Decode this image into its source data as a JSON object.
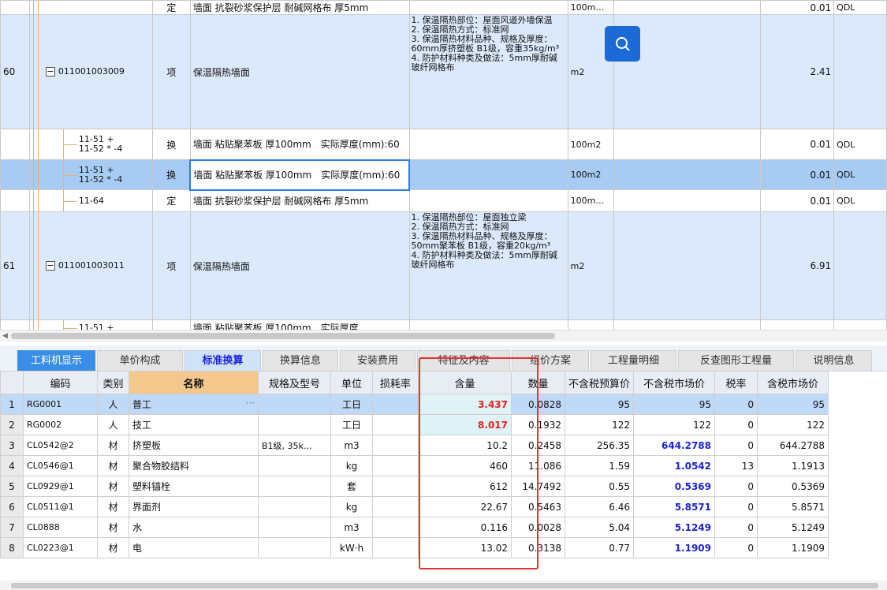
{
  "top_table": {
    "rows": [
      {
        "num": "",
        "code": "",
        "type": "定",
        "name": "墙面 抗裂砂浆保护层 耐碱网格布 厚5mm",
        "desc": "",
        "unit": "100m…",
        "qty": "0.01",
        "qdl": "QDL"
      },
      {
        "num": "60",
        "code": "011001003009",
        "type": "项",
        "name": "保温隔热墙面",
        "desc": "1. 保温隔热部位：屋面风道外墙保温\n2. 保温隔热方式：标准网\n3. 保温隔热材料品种、规格及厚度：60mm厚挤塑板 B1级，容重35kg/m³\n4. 防护材料种类及做法：5mm厚耐碱玻纤网格布",
        "unit": "m2",
        "qty": "2.41",
        "qdl": ""
      },
      {
        "num": "",
        "code": "11-51 +\n11-52 * -4",
        "type": "换",
        "name": "墙面 粘贴聚苯板 厚100mm　实际厚度(mm):60",
        "desc": "",
        "unit": "100m2",
        "qty": "0.01",
        "qdl": "QDL"
      },
      {
        "num": "",
        "code": "11-51 +\n11-52 * -4",
        "type": "换",
        "name": "墙面 粘贴聚苯板 厚100mm　实际厚度(mm):60",
        "desc": "",
        "unit": "100m2",
        "qty": "0.01",
        "qdl": "QDL"
      },
      {
        "num": "",
        "code": "11-64",
        "type": "定",
        "name": "墙面 抗裂砂浆保护层 耐碱网格布 厚5mm",
        "desc": "",
        "unit": "100m…",
        "qty": "0.01",
        "qdl": "QDL"
      },
      {
        "num": "61",
        "code": "011001003011",
        "type": "项",
        "name": "保温隔热墙面",
        "desc": "1. 保温隔热部位：屋面独立梁\n2. 保温隔热方式：标准网\n3. 保温隔热材料品种、规格及厚度：50mm聚苯板 B1级，容重20kg/m³\n4. 防护材料种类及做法：5mm厚耐碱玻纤网格布",
        "unit": "m2",
        "qty": "6.91",
        "qdl": ""
      },
      {
        "num": "",
        "code": "11-51 +",
        "type": "",
        "name": "墙面 粘贴聚苯板 厚100mm　实际厚度",
        "desc": "",
        "unit": "",
        "qty": "",
        "qdl": ""
      }
    ]
  },
  "tabs": [
    "工料机显示",
    "单价构成",
    "标准换算",
    "换算信息",
    "安装费用",
    "特征及内容",
    "组价方案",
    "工程量明细",
    "反查图形工程量",
    "说明信息"
  ],
  "bottom_table": {
    "headers": [
      "编码",
      "类别",
      "名称",
      "规格及型号",
      "单位",
      "损耗率",
      "含量",
      "数量",
      "不含税预算价",
      "不含税市场价",
      "税率",
      "含税市场价"
    ],
    "rows": [
      {
        "n": "1",
        "code": "RG0001",
        "cat": "人",
        "name": "普工",
        "spec": "",
        "unit": "工日",
        "loss": "",
        "qty": "3.437",
        "amount": "0.0828",
        "budget": "95",
        "market": "95",
        "tax": "0",
        "taxm": "95"
      },
      {
        "n": "2",
        "code": "RG0002",
        "cat": "人",
        "name": "技工",
        "spec": "",
        "unit": "工日",
        "loss": "",
        "qty": "8.017",
        "amount": "0.1932",
        "budget": "122",
        "market": "122",
        "tax": "0",
        "taxm": "122"
      },
      {
        "n": "3",
        "code": "CL0542@2",
        "cat": "材",
        "name": "挤塑板",
        "spec": "B1级, 35k…",
        "unit": "m3",
        "loss": "",
        "qty": "10.2",
        "amount": "0.2458",
        "budget": "256.35",
        "market": "644.2788",
        "tax": "0",
        "taxm": "644.2788"
      },
      {
        "n": "4",
        "code": "CL0546@1",
        "cat": "材",
        "name": "聚合物胶结料",
        "spec": "",
        "unit": "kg",
        "loss": "",
        "qty": "460",
        "amount": "11.086",
        "budget": "1.59",
        "market": "1.0542",
        "tax": "13",
        "taxm": "1.1913"
      },
      {
        "n": "5",
        "code": "CL0929@1",
        "cat": "材",
        "name": "塑料锚栓",
        "spec": "",
        "unit": "套",
        "loss": "",
        "qty": "612",
        "amount": "14.7492",
        "budget": "0.55",
        "market": "0.5369",
        "tax": "0",
        "taxm": "0.5369"
      },
      {
        "n": "6",
        "code": "CL0511@1",
        "cat": "材",
        "name": "界面剂",
        "spec": "",
        "unit": "kg",
        "loss": "",
        "qty": "22.67",
        "amount": "0.5463",
        "budget": "6.46",
        "market": "5.8571",
        "tax": "0",
        "taxm": "5.8571"
      },
      {
        "n": "7",
        "code": "CL0888",
        "cat": "材",
        "name": "水",
        "spec": "",
        "unit": "m3",
        "loss": "",
        "qty": "0.116",
        "amount": "0.0028",
        "budget": "5.04",
        "market": "5.1249",
        "tax": "0",
        "taxm": "5.1249"
      },
      {
        "n": "8",
        "code": "CL0223@1",
        "cat": "材",
        "name": "电",
        "spec": "",
        "unit": "kW·h",
        "loss": "",
        "qty": "13.02",
        "amount": "0.3138",
        "budget": "0.77",
        "market": "1.1909",
        "tax": "0",
        "taxm": "1.1909"
      }
    ]
  },
  "colors": {
    "accent": "#3a8ee6",
    "highlight_red": "#e81f1f",
    "market_blue": "#1a23d6",
    "annotation_box": "#e63232"
  },
  "icons": {
    "search": "search-icon",
    "collapse": "minus-box-icon",
    "more": "ellipsis-icon",
    "scroll_left": "arrow-left-icon"
  }
}
